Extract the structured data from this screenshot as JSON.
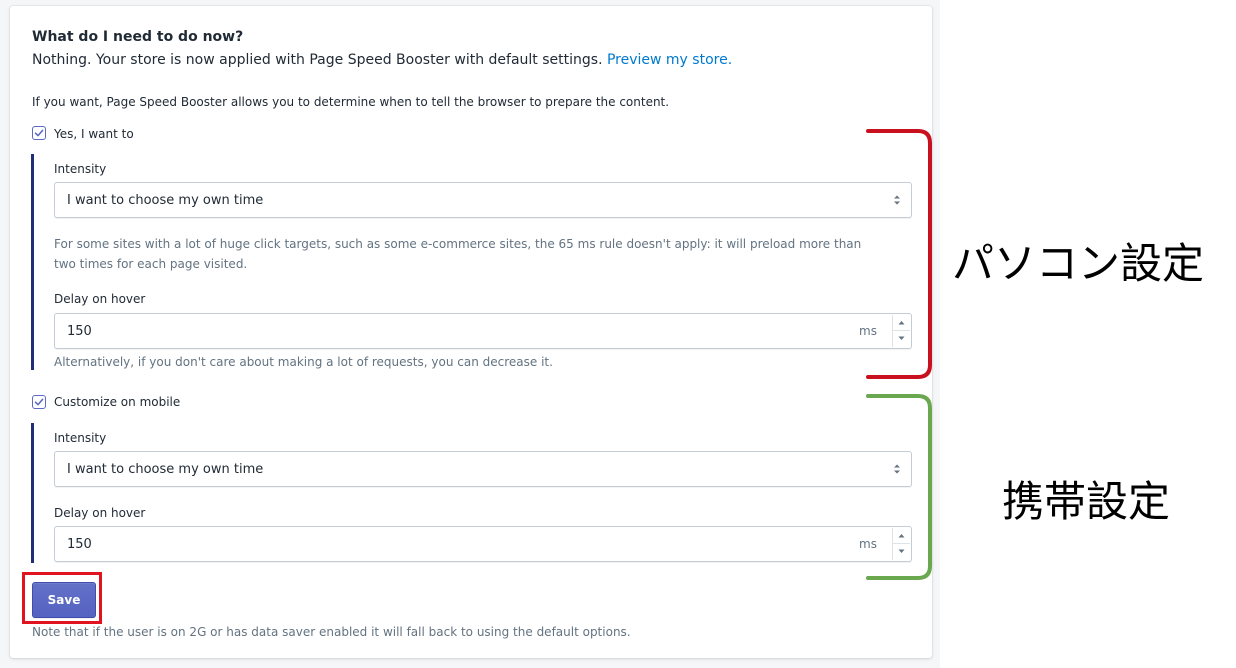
{
  "card": {
    "heading": "What do I need to do now?",
    "lead_text": "Nothing. Your store is now applied with Page Speed Booster with default settings.",
    "preview_link": "Preview my store.",
    "intro": "If you want, Page Speed Booster allows you to determine when to tell the browser to prepare the content."
  },
  "desktop": {
    "checkbox_label": "Yes, I want to",
    "checked": true,
    "intensity_label": "Intensity",
    "intensity_value": "I want to choose my own time",
    "help_line1": "For some sites with a lot of huge click targets, such as some e-commerce sites, the 65 ms rule doesn't apply: it will preload more than",
    "help_line2": "two times for each page visited.",
    "delay_label": "Delay on hover",
    "delay_value": "150",
    "delay_unit": "ms",
    "delay_help": "Alternatively, if you don't care about making a lot of requests, you can decrease it."
  },
  "mobile": {
    "checkbox_label": "Customize on mobile",
    "checked": true,
    "intensity_label": "Intensity",
    "intensity_value": "I want to choose my own time",
    "delay_label": "Delay on hover",
    "delay_value": "150",
    "delay_unit": "ms"
  },
  "footer": {
    "save_label": "Save",
    "note": "Note that if the user is on 2G or has data saver enabled it will fall back to using the default options."
  },
  "annotations": {
    "desktop_label": "パソコン設定",
    "mobile_label": "携帯設定",
    "desktop_bracket_color": "#c8101e",
    "mobile_bracket_color": "#6aa84f",
    "save_highlight_color": "#e0131f"
  },
  "colors": {
    "accent": "#5c6ac4",
    "link": "#007ace",
    "section_bar": "#202e78"
  }
}
